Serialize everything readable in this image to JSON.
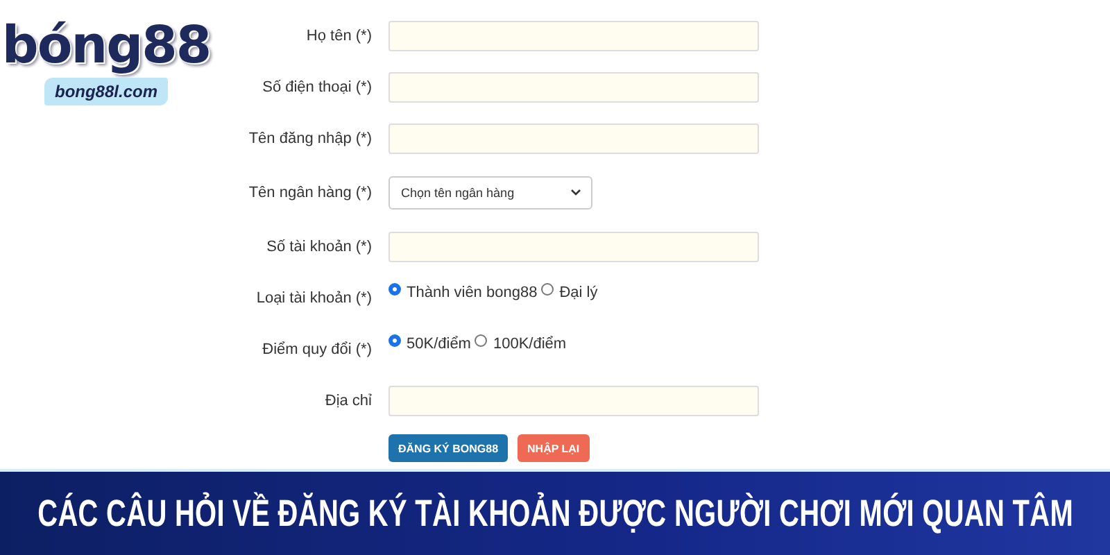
{
  "logo": {
    "brand": "bóng88",
    "domain": "bong88l.com"
  },
  "form": {
    "fields": [
      {
        "kind": "text",
        "label": "Họ tên (*)"
      },
      {
        "kind": "text",
        "label": "Số điện thoại (*)"
      },
      {
        "kind": "text",
        "label": "Tên đăng nhập (*)"
      },
      {
        "kind": "select",
        "label": "Tên ngân hàng (*)",
        "value": "Chọn tên ngân hàng"
      },
      {
        "kind": "text",
        "label": "Số tài khoản (*)"
      },
      {
        "kind": "radio",
        "label": "Loại tài khoản (*)",
        "options": [
          {
            "label": "Thành viên bong88",
            "selected": true
          },
          {
            "label": "Đại lý",
            "selected": false
          }
        ]
      },
      {
        "kind": "radio",
        "label": "Điểm quy đổi (*)",
        "options": [
          {
            "label": "50K/điểm",
            "selected": true
          },
          {
            "label": "100K/điểm",
            "selected": false
          }
        ]
      },
      {
        "kind": "text",
        "label": "Địa chỉ"
      }
    ],
    "buttons": [
      {
        "kind": "primary",
        "label": "ĐĂNG KÝ BONG88"
      },
      {
        "kind": "reset",
        "label": "NHẬP LẠI"
      }
    ]
  },
  "banner": {
    "title": "CÁC CÂU HỎI VỀ ĐĂNG KÝ TÀI KHOẢN ĐƯỢC NGƯỜI CHƠI MỚI QUAN TÂM"
  }
}
